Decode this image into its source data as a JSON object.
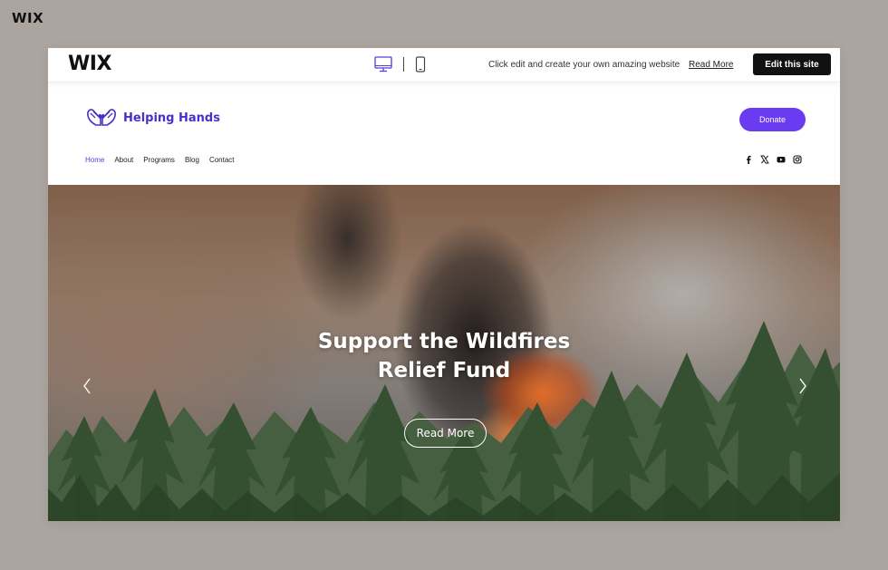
{
  "editor": {
    "corner_logo": "WIX",
    "bar_logo": "WIX",
    "promo_text": "Click edit and create your own amazing website",
    "promo_link": "Read More",
    "edit_button": "Edit this site",
    "view_modes": [
      "desktop-icon",
      "mobile-icon"
    ]
  },
  "site": {
    "brand": {
      "name": "Helping Hands",
      "icon": "hands-heart-icon",
      "color": "#4b2ec9"
    },
    "donate_button": "Donate",
    "accent_color": "#6a3bf0",
    "nav": [
      {
        "label": "Home",
        "active": true
      },
      {
        "label": "About",
        "active": false
      },
      {
        "label": "Programs",
        "active": false
      },
      {
        "label": "Blog",
        "active": false
      },
      {
        "label": "Contact",
        "active": false
      }
    ],
    "socials": [
      "facebook-icon",
      "x-icon",
      "youtube-icon",
      "instagram-icon"
    ]
  },
  "hero": {
    "title_line1": "Support the Wildfires",
    "title_line2": "Relief Fund",
    "button": "Read More",
    "prev_icon": "chevron-left-icon",
    "next_icon": "chevron-right-icon"
  }
}
